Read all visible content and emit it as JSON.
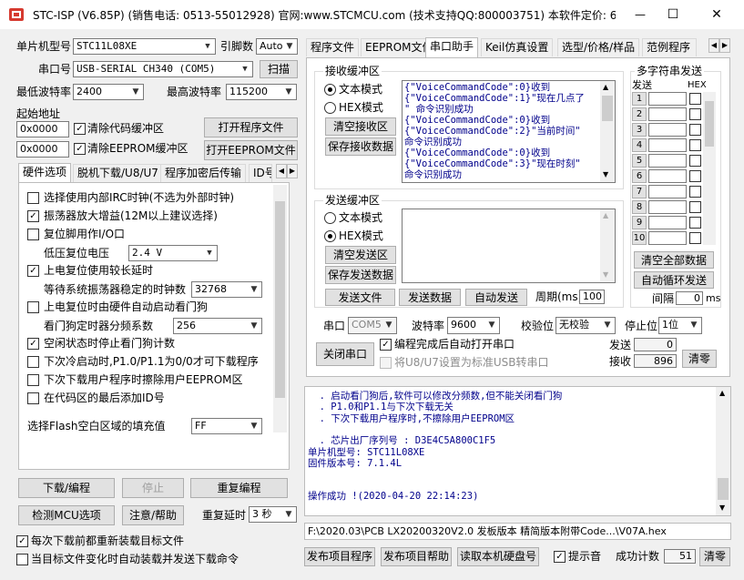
{
  "window": {
    "title": "STC-ISP (V6.85P) (销售电话: 0513-55012928) 官网:www.STCMCU.com  (技术支持QQ:800003751) 本软件定价: 6...",
    "minimize": "—",
    "maximize": "☐",
    "close": "✕"
  },
  "left": {
    "mcu_model_label": "单片机型号",
    "mcu_model_value": "STC11L08XE",
    "pin_count_label": "引脚数",
    "pin_count_value": "Auto",
    "port_label": "串口号",
    "port_value": "USB-SERIAL CH340 (COM5)",
    "scan_button": "扫描",
    "min_baud_label": "最低波特率",
    "min_baud_value": "2400",
    "max_baud_label": "最高波特率",
    "max_baud_value": "115200",
    "start_addr_label": "起始地址",
    "addr1": "0x0000",
    "clear_code_label": "清除代码缓冲区",
    "open_program_button": "打开程序文件",
    "addr2": "0x0000",
    "clear_eeprom_label": "清除EEPROM缓冲区",
    "open_eeprom_button": "打开EEPROM文件",
    "tabs": [
      "硬件选项",
      "脱机下载/U8/U7",
      "程序加密后传输",
      "ID号"
    ],
    "options": [
      {
        "label": "选择使用内部IRC时钟(不选为外部时钟)",
        "checked": false
      },
      {
        "label": "振荡器放大增益(12M以上建议选择)",
        "checked": true
      },
      {
        "label": "复位脚用作I/O口",
        "checked": false
      },
      {
        "label": "低压复位电压",
        "value": "2.4 V"
      },
      {
        "label": "上电复位使用较长延时",
        "checked": true
      },
      {
        "label": "等待系统振荡器稳定的时钟数",
        "value": "32768"
      },
      {
        "label": "上电复位时由硬件自动启动看门狗",
        "checked": false
      },
      {
        "label": "看门狗定时器分频系数",
        "value": "256"
      },
      {
        "label": "空闲状态时停止看门狗计数",
        "checked": true
      },
      {
        "label": "下次冷启动时,P1.0/P1.1为0/0才可下载程序",
        "checked": false
      },
      {
        "label": "下次下载用户程序时擦除用户EEPROM区",
        "checked": false
      },
      {
        "label": "在代码区的最后添加ID号",
        "checked": false
      }
    ],
    "fill_label": "选择Flash空白区域的填充值",
    "fill_value": "FF",
    "download_button": "下载/编程",
    "stop_button": "停止",
    "reprogram_button": "重复编程",
    "check_mcu_button": "检测MCU选项",
    "help_button": "注意/帮助",
    "repeat_delay_label": "重复延时",
    "repeat_delay_value": "3 秒",
    "reload_label": "每次下载前都重新装载目标文件",
    "auto_load_label": "当目标文件变化时自动装载并发送下载命令"
  },
  "right": {
    "tabs": [
      "程序文件",
      "EEPROM文件",
      "串口助手",
      "Keil仿真设置",
      "选型/价格/样品",
      "范例程序"
    ],
    "recv_group": "接收缓冲区",
    "text_mode": "文本模式",
    "hex_mode": "HEX模式",
    "clear_recv_button": "清空接收区",
    "save_recv_button": "保存接收数据",
    "recv_lines": [
      "{\"VoiceCommandCode\":0}收到",
      "{\"VoiceCommandCode\":1}\"现在几点了",
      "\" 命令识别成功",
      "{\"VoiceCommandCode\":0}收到",
      "{\"VoiceCommandCode\":2}\"当前时间\"",
      "命令识别成功",
      "{\"VoiceCommandCode\":0}收到",
      "{\"VoiceCommandCode\":3}\"现在时刻\"",
      "命令识别成功"
    ],
    "send_group": "发送缓冲区",
    "send_text_mode": "文本模式",
    "send_hex_mode": "HEX模式",
    "clear_send_button": "清空发送区",
    "save_send_button": "保存发送数据",
    "send_file_button": "发送文件",
    "send_data_button": "发送数据",
    "auto_send_button": "自动发送",
    "period_label": "周期(ms)",
    "period_value": "100",
    "multi_group": "多字符串发送",
    "multi_send_header": "发送",
    "multi_hex_header": "HEX",
    "multi_rows": [
      "1",
      "2",
      "3",
      "4",
      "5",
      "6",
      "7",
      "8",
      "9",
      "10"
    ],
    "clear_all_button": "清空全部数据",
    "auto_loop_button": "自动循环发送",
    "interval_label": "间隔",
    "interval_value": "0",
    "interval_unit": "ms",
    "serial_port_label": "串口",
    "serial_port_value": "COM5",
    "baud_label": "波特率",
    "baud_value": "9600",
    "parity_label": "校验位",
    "parity_value": "无校验",
    "stop_bit_label": "停止位",
    "stop_bit_value": "1位",
    "close_port_button": "关闭串口",
    "auto_open_label": "编程完成后自动打开串口",
    "usb_label": "将U8/U7设置为标准USB转串口",
    "sent_label": "发送",
    "sent_value": "0",
    "recv_label": "接收",
    "recv_value": "896",
    "clear_count_button": "清零",
    "log_lines": [
      "  . 启动看门狗后,软件可以修改分频数,但不能关闭看门狗",
      "  . P1.0和P1.1与下次下载无关",
      "  . 下次下载用户程序时,不擦除用户EEPROM区",
      "",
      "  . 芯片出厂序列号 : D3E4C5A800C1F5",
      "单片机型号: STC11L08XE",
      "固件版本号: 7.1.4L",
      "",
      "",
      "操作成功 !(2020-04-20 22:14:23)"
    ],
    "path": "F:\\2020.03\\PCB LX20200320V2.0 发板版本 精简版本附带Code...\\V07A.hex",
    "publish_button": "发布项目程序",
    "publish_help_button": "发布项目帮助",
    "read_disk_button": "读取本机硬盘号",
    "sound_label": "提示音",
    "success_count_label": "成功计数",
    "success_count_value": "51",
    "clear_success_button": "清零"
  }
}
